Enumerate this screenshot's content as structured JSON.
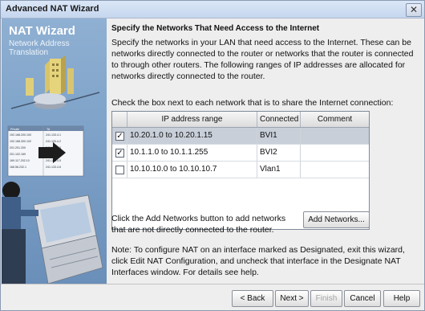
{
  "window": {
    "title": "Advanced NAT Wizard",
    "close_glyph": "✕"
  },
  "sidebar": {
    "title": "NAT Wizard",
    "subtitle": "Network Address Translation",
    "illustration_table": {
      "headers": [
        "Private",
        "TA"
      ],
      "rows": [
        [
          "192.168.200.100",
          "241.133.4.1"
        ],
        [
          "192.168.300.102",
          "241.133.4.2"
        ],
        [
          "201.201.200",
          "241.133.4.3"
        ],
        [
          "201.102.169",
          "241.133.4.4"
        ],
        [
          "169.117.202.10",
          "241.133.4.5"
        ],
        [
          "166.56.232.1",
          "241.133.4.6"
        ]
      ]
    }
  },
  "main": {
    "heading": "Specify the Networks That Need Access to the Internet",
    "intro": "Specify the networks in your LAN that need access to the Internet. These can be networks directly connected to the router or networks that the router is connected to through other routers. The following ranges of IP addresses are allocated for networks directly connected to the router.",
    "instruction": "Check the box next to each network that is to share the Internet connection:",
    "table": {
      "columns": [
        "IP address range",
        "Connected",
        "Comment"
      ],
      "rows": [
        {
          "checked": true,
          "range": "10.20.1.0 to 10.20.1.15",
          "connected": "BVI1",
          "comment": ""
        },
        {
          "checked": true,
          "range": "10.1.1.0 to 10.1.1.255",
          "connected": "BVI2",
          "comment": ""
        },
        {
          "checked": false,
          "range": "10.10.10.0 to 10.10.10.7",
          "connected": "Vlan1",
          "comment": ""
        }
      ]
    },
    "add_hint": "Click the Add Networks button to add networks that are not directly connected to the router.",
    "add_button": "Add Networks...",
    "note": "Note: To configure NAT on an interface marked as Designated, exit this wizard, click Edit NAT Configuration, and uncheck that interface in the Designate NAT Interfaces window. For details see help."
  },
  "footer": {
    "back": "< Back",
    "next": "Next >",
    "finish": "Finish",
    "cancel": "Cancel",
    "help": "Help"
  },
  "colors": {
    "sidebar_blue": "#7fa3c9",
    "selected_row": "#c8cfd9"
  }
}
